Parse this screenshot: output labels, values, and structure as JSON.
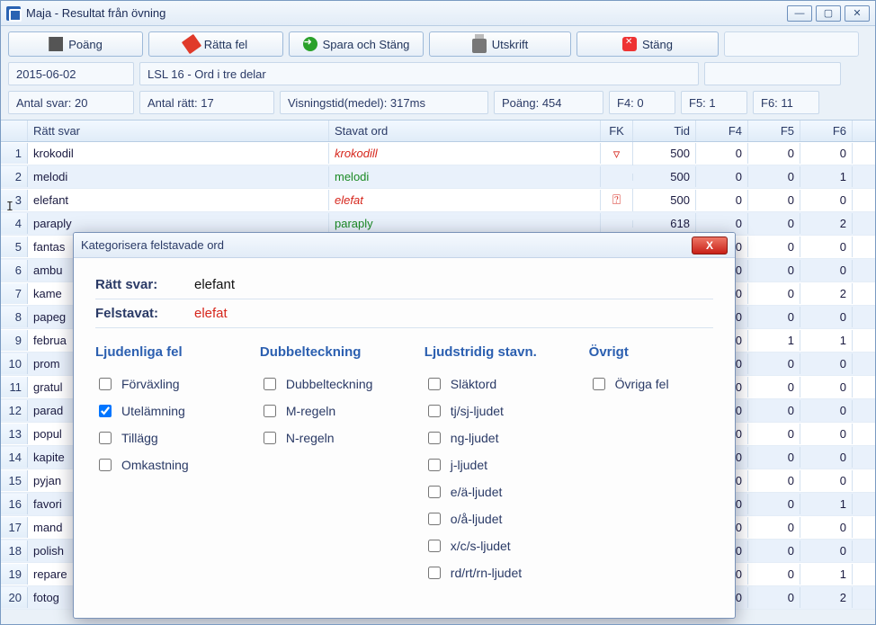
{
  "window": {
    "title": "Maja - Resultat från övning"
  },
  "toolbar": {
    "poang": "Poäng",
    "ratta": "Rätta fel",
    "spara": "Spara och Stäng",
    "utskrift": "Utskrift",
    "stang": "Stäng"
  },
  "info1": {
    "date": "2015-06-02",
    "exercise": "LSL 16 - Ord i tre delar"
  },
  "info2": {
    "antal_svar": "Antal svar: 20",
    "antal_ratt": "Antal rätt: 17",
    "visningstid": "Visningstid(medel): 317ms",
    "poang": "Poäng: 454",
    "f4": "F4: 0",
    "f5": "F5: 1",
    "f6": "F6: 11"
  },
  "headers": {
    "num": "",
    "ratt": "Rätt svar",
    "stav": "Stavat ord",
    "fk": "FK",
    "tid": "Tid",
    "f4": "F4",
    "f5": "F5",
    "f6": "F6"
  },
  "rows": [
    {
      "n": "1",
      "ratt": "krokodil",
      "stav": "krokodill",
      "ok": false,
      "fk": "▿",
      "tid": "500",
      "f4": "0",
      "f5": "0",
      "f6": "0"
    },
    {
      "n": "2",
      "ratt": "melodi",
      "stav": "melodi",
      "ok": true,
      "fk": "",
      "tid": "500",
      "f4": "0",
      "f5": "0",
      "f6": "1"
    },
    {
      "n": "3",
      "ratt": "elefant",
      "stav": "elefat",
      "ok": false,
      "fk": "⍰",
      "tid": "500",
      "f4": "0",
      "f5": "0",
      "f6": "0"
    },
    {
      "n": "4",
      "ratt": "paraply",
      "stav": "paraply",
      "ok": true,
      "fk": "",
      "tid": "618",
      "f4": "0",
      "f5": "0",
      "f6": "2"
    },
    {
      "n": "5",
      "ratt": "fantas",
      "stav": "",
      "ok": true,
      "fk": "",
      "tid": "",
      "f4": "0",
      "f5": "0",
      "f6": "0"
    },
    {
      "n": "6",
      "ratt": "ambu",
      "stav": "",
      "ok": true,
      "fk": "",
      "tid": "",
      "f4": "0",
      "f5": "0",
      "f6": "0"
    },
    {
      "n": "7",
      "ratt": "kame",
      "stav": "",
      "ok": true,
      "fk": "",
      "tid": "",
      "f4": "0",
      "f5": "0",
      "f6": "2"
    },
    {
      "n": "8",
      "ratt": "papeg",
      "stav": "",
      "ok": true,
      "fk": "",
      "tid": "",
      "f4": "0",
      "f5": "0",
      "f6": "0"
    },
    {
      "n": "9",
      "ratt": "februa",
      "stav": "",
      "ok": true,
      "fk": "",
      "tid": "",
      "f4": "0",
      "f5": "1",
      "f6": "1"
    },
    {
      "n": "10",
      "ratt": "prom",
      "stav": "",
      "ok": true,
      "fk": "",
      "tid": "",
      "f4": "0",
      "f5": "0",
      "f6": "0"
    },
    {
      "n": "11",
      "ratt": "gratul",
      "stav": "",
      "ok": true,
      "fk": "",
      "tid": "",
      "f4": "0",
      "f5": "0",
      "f6": "0"
    },
    {
      "n": "12",
      "ratt": "parad",
      "stav": "",
      "ok": true,
      "fk": "",
      "tid": "",
      "f4": "0",
      "f5": "0",
      "f6": "0"
    },
    {
      "n": "13",
      "ratt": "popul",
      "stav": "",
      "ok": true,
      "fk": "",
      "tid": "",
      "f4": "0",
      "f5": "0",
      "f6": "0"
    },
    {
      "n": "14",
      "ratt": "kapite",
      "stav": "",
      "ok": true,
      "fk": "",
      "tid": "",
      "f4": "0",
      "f5": "0",
      "f6": "0"
    },
    {
      "n": "15",
      "ratt": "pyjan",
      "stav": "",
      "ok": true,
      "fk": "",
      "tid": "",
      "f4": "0",
      "f5": "0",
      "f6": "0"
    },
    {
      "n": "16",
      "ratt": "favori",
      "stav": "",
      "ok": true,
      "fk": "",
      "tid": "",
      "f4": "0",
      "f5": "0",
      "f6": "1"
    },
    {
      "n": "17",
      "ratt": "mand",
      "stav": "",
      "ok": true,
      "fk": "",
      "tid": "",
      "f4": "0",
      "f5": "0",
      "f6": "0"
    },
    {
      "n": "18",
      "ratt": "polish",
      "stav": "",
      "ok": true,
      "fk": "",
      "tid": "",
      "f4": "0",
      "f5": "0",
      "f6": "0"
    },
    {
      "n": "19",
      "ratt": "repare",
      "stav": "",
      "ok": true,
      "fk": "",
      "tid": "",
      "f4": "0",
      "f5": "0",
      "f6": "1"
    },
    {
      "n": "20",
      "ratt": "fotog",
      "stav": "",
      "ok": true,
      "fk": "",
      "tid": "",
      "f4": "0",
      "f5": "0",
      "f6": "2"
    }
  ],
  "dialog": {
    "title": "Kategorisera felstavade ord",
    "ratt_label": "Rätt svar:",
    "ratt_value": "elefant",
    "fel_label": "Felstavat:",
    "fel_value": "elefat",
    "cat1_h": "Ljudenliga fel",
    "cat1": [
      "Förväxling",
      "Utelämning",
      "Tillägg",
      "Omkastning"
    ],
    "cat1_checked": [
      false,
      true,
      false,
      false
    ],
    "cat2_h": "Dubbelteckning",
    "cat2": [
      "Dubbelteckning",
      "M-regeln",
      "N-regeln"
    ],
    "cat3_h": "Ljudstridig stavn.",
    "cat3": [
      "Släktord",
      "tj/sj-ljudet",
      "ng-ljudet",
      "j-ljudet",
      "e/ä-ljudet",
      "o/å-ljudet",
      "x/c/s-ljudet",
      "rd/rt/rn-ljudet"
    ],
    "cat4_h": "Övrigt",
    "cat4": [
      "Övriga fel"
    ]
  }
}
